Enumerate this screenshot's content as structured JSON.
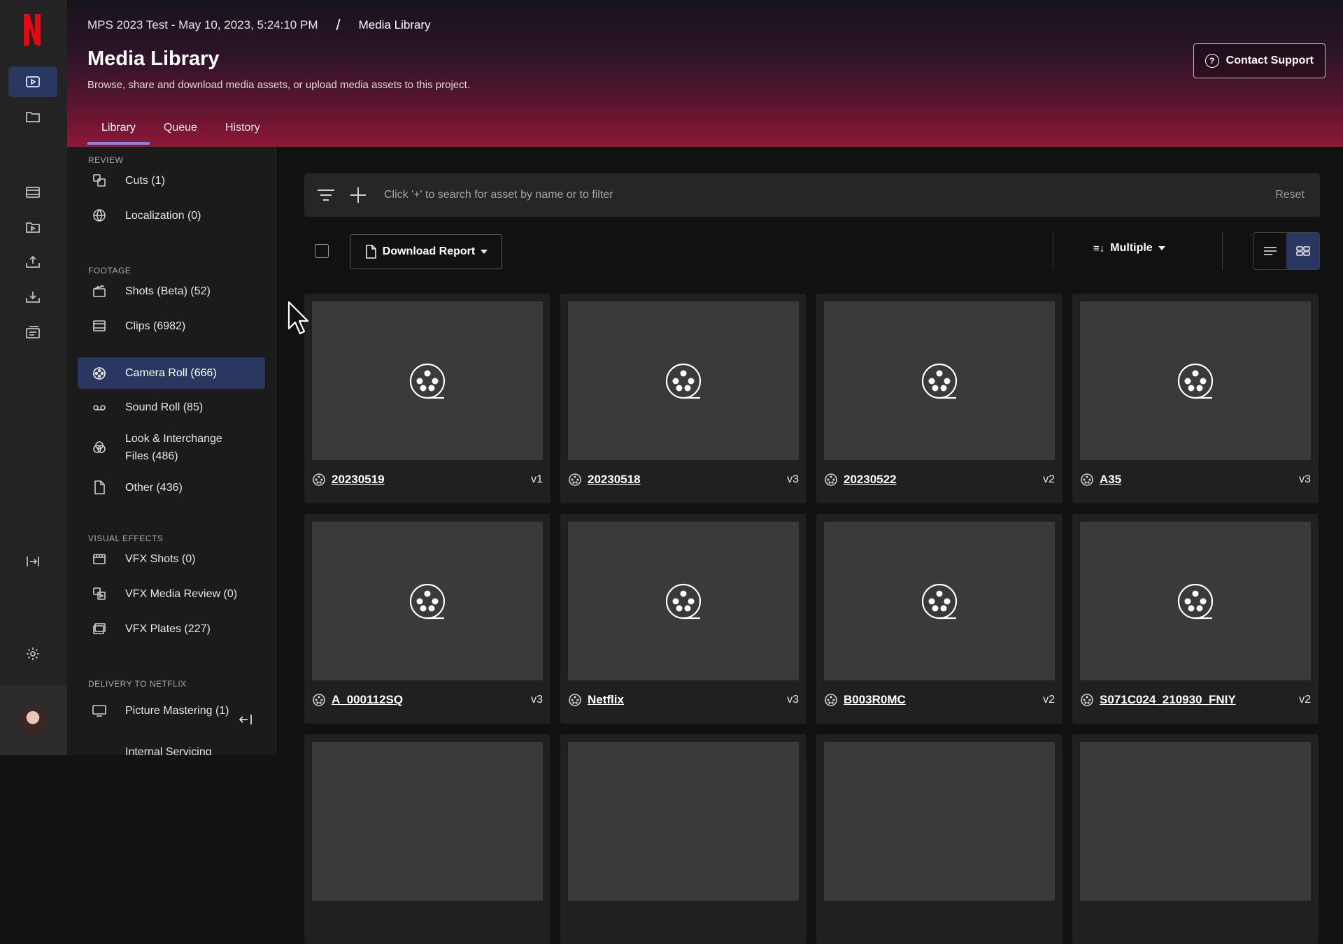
{
  "breadcrumb": {
    "project": "MPS 2023 Test - May 10, 2023, 5:24:10 PM",
    "separator": "/",
    "current": "Media Library"
  },
  "header": {
    "title": "Media Library",
    "subtitle": "Browse, share and download media assets, or upload media assets to this project.",
    "contact_support": "Contact Support"
  },
  "tabs": [
    {
      "label": "Library",
      "active": true
    },
    {
      "label": "Queue",
      "active": false
    },
    {
      "label": "History",
      "active": false
    }
  ],
  "sidebar": {
    "sections": [
      "REVIEW",
      "FOOTAGE",
      "VISUAL EFFECTS",
      "DELIVERY TO NETFLIX"
    ],
    "items": [
      {
        "label": "Cuts (1)",
        "icon": "cuts-icon"
      },
      {
        "label": "Localization (0)",
        "icon": "globe-icon"
      },
      {
        "label": "Shots (Beta) (52)",
        "icon": "clapper-icon"
      },
      {
        "label": "Clips (6982)",
        "icon": "film-icon"
      },
      {
        "label": "Camera Roll (666)",
        "icon": "film-reel-icon",
        "active": true
      },
      {
        "label": "Sound Roll (85)",
        "icon": "tape-icon"
      },
      {
        "label": "Look & Interchange Files (486)",
        "icon": "color-circles-icon"
      },
      {
        "label": "Other (436)",
        "icon": "file-icon"
      },
      {
        "label": "VFX Shots (0)",
        "icon": "vfx-shots-icon"
      },
      {
        "label": "VFX Media Review (0)",
        "icon": "vfx-review-icon"
      },
      {
        "label": "VFX Plates (227)",
        "icon": "plates-icon"
      },
      {
        "label": "Picture Mastering (1)",
        "icon": "monitor-icon"
      },
      {
        "label": "Internal Servicing",
        "icon": "servicing-icon"
      }
    ]
  },
  "search": {
    "placeholder": "Click '+' to search for asset by name or to filter",
    "reset": "Reset"
  },
  "toolbar": {
    "download_report": "Download Report",
    "sort_label": "Multiple"
  },
  "assets": [
    {
      "name": "20230519",
      "version": "v1"
    },
    {
      "name": "20230518",
      "version": "v3"
    },
    {
      "name": "20230522",
      "version": "v2"
    },
    {
      "name": "A35",
      "version": "v3"
    },
    {
      "name": "A_000112SQ",
      "version": "v3"
    },
    {
      "name": "Netflix",
      "version": "v3"
    },
    {
      "name": "B003R0MC",
      "version": "v2"
    },
    {
      "name": "S071C024_210930_FNIY",
      "version": "v2"
    }
  ],
  "colors": {
    "accent": "#6f8cff",
    "active_bg": "#2a3761",
    "brand": "#e50914"
  }
}
